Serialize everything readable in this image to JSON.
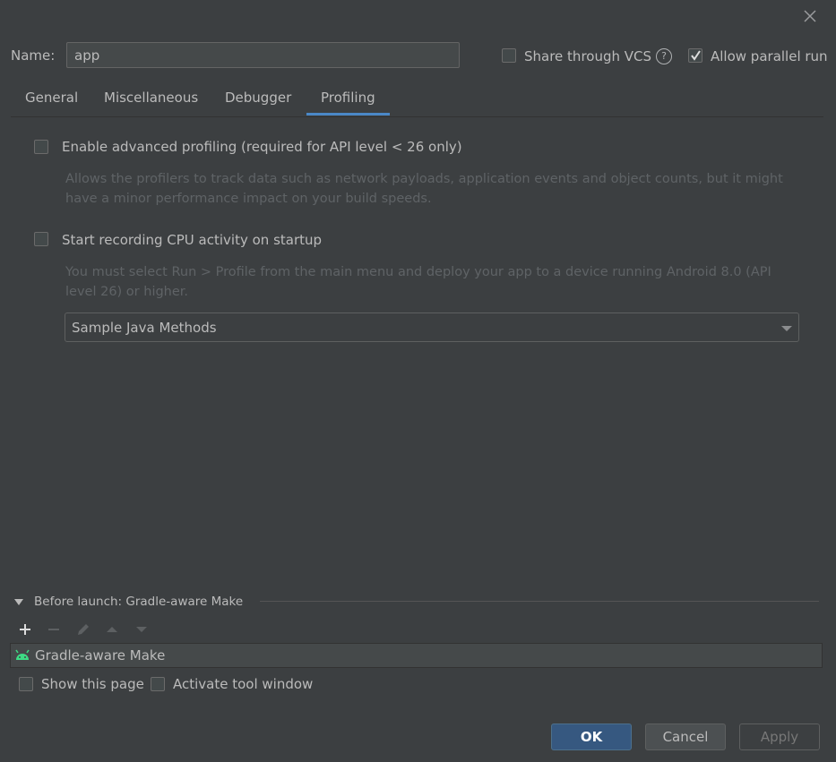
{
  "dialog": {
    "name_label": "Name:",
    "name_value": "app",
    "share_vcs_label": "Share through VCS",
    "share_vcs_checked": false,
    "allow_parallel_label": "Allow parallel run",
    "allow_parallel_checked": true,
    "help_glyph": "?"
  },
  "tabs": [
    {
      "label": "General",
      "active": false
    },
    {
      "label": "Miscellaneous",
      "active": false
    },
    {
      "label": "Debugger",
      "active": false
    },
    {
      "label": "Profiling",
      "active": true
    }
  ],
  "profiling": {
    "advanced_label": "Enable advanced profiling (required for API level < 26 only)",
    "advanced_checked": false,
    "advanced_desc_1": "Allows the profilers to track data such as network payloads, application events and object counts, but it might",
    "advanced_desc_2": "have a minor performance impact on your build speeds.",
    "cpu_label": "Start recording CPU activity on startup",
    "cpu_checked": false,
    "cpu_desc_1": "You must select Run > Profile from the main menu and deploy your app to a device running Android 8.0 (API",
    "cpu_desc_2": "level 26) or higher.",
    "cpu_config_selected": "Sample Java Methods"
  },
  "before_launch": {
    "header": "Before launch: Gradle-aware Make",
    "tools": [
      "add-icon",
      "remove-icon",
      "edit-icon",
      "move-up-icon",
      "move-down-icon"
    ],
    "items": [
      {
        "label": "Gradle-aware Make",
        "icon": "android-icon"
      }
    ],
    "show_page_label": "Show this page",
    "show_page_checked": false,
    "activate_tool_label": "Activate tool window",
    "activate_tool_checked": false
  },
  "buttons": {
    "ok": "OK",
    "cancel": "Cancel",
    "apply": "Apply"
  },
  "colors": {
    "background": "#3c3f41",
    "accent": "#4a88c7",
    "ok_button": "#365880",
    "android_green": "#3ddc84"
  }
}
